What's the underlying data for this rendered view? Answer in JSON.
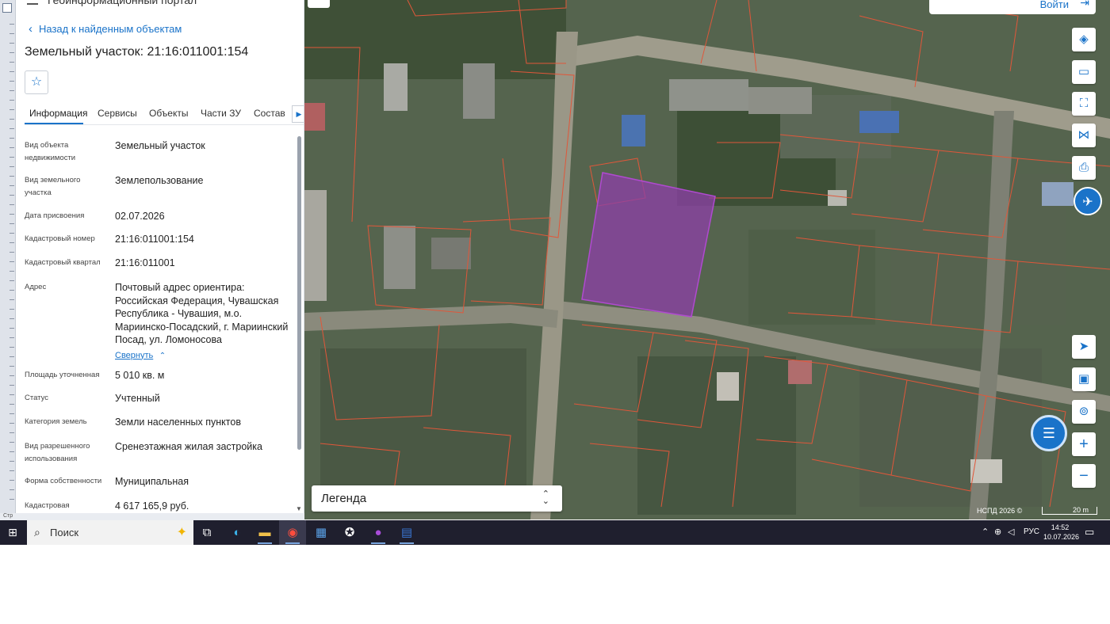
{
  "panel": {
    "header_cut": "Геоинформационный портал",
    "back_link": "Назад к найденным объектам",
    "title": "Земельный участок: 21:16:011001:154",
    "tabs": [
      "Информация",
      "Сервисы",
      "Объекты",
      "Части ЗУ",
      "Состав"
    ],
    "rows": [
      {
        "label": "Вид объекта недвижимости",
        "value": "Земельный участок"
      },
      {
        "label": "Вид земельного участка",
        "value": "Землепользование"
      },
      {
        "label": "Дата присвоения",
        "value": "02.07.2026"
      },
      {
        "label": "Кадастровый номер",
        "value": "21:16:011001:154"
      },
      {
        "label": "Кадастровый квартал",
        "value": "21:16:011001"
      },
      {
        "label": "Адрес",
        "value": "Почтовый адрес ориентира: Российская Федерация, Чувашская Республика - Чувашия, м.о. Мариинско-Посадский, г. Мариинский Посад, ул. Ломоносова"
      },
      {
        "label": "Площадь уточненная",
        "value": "5 010 кв. м"
      },
      {
        "label": "Статус",
        "value": "Учтенный"
      },
      {
        "label": "Категория земель",
        "value": "Земли населенных пунктов"
      },
      {
        "label": "Вид разрешенного использования",
        "value": "Сренеэтажная жилая застройка"
      },
      {
        "label": "Форма собственности",
        "value": "Муниципальная"
      },
      {
        "label": "Кадастровая",
        "value": "4 617 165,9 руб."
      }
    ],
    "collapse_link": "Свернуть",
    "status_strip": "Стр"
  },
  "map": {
    "login_label": "Войти",
    "legend_label": "Легенда",
    "attribution": "НСПД 2026 ©",
    "scale_label": "20 m",
    "highlight_color": "#8e3fa8",
    "parcel_line_color": "#e0573a"
  },
  "taskbar": {
    "search_placeholder": "Поиск",
    "language": "РУС",
    "time": "14:52",
    "date": "10.07.2026"
  }
}
